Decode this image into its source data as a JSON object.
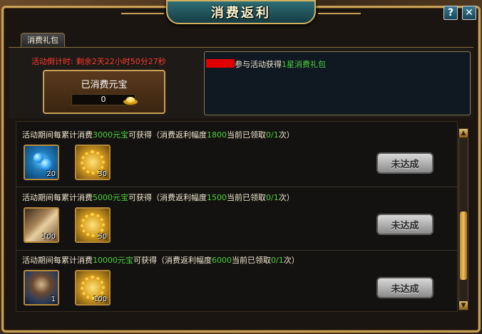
{
  "window": {
    "title": "消费返利",
    "help_label": "?",
    "close_label": "✕"
  },
  "tabs": [
    {
      "label": "消费礼包"
    }
  ],
  "countdown": {
    "label": "活动倒计时:",
    "value": "剩余2天22小时50分27秒"
  },
  "spent": {
    "title": "已消费元宝",
    "value": "0",
    "icon": "gold-ingot-icon"
  },
  "info": {
    "text_prefix": "参与活动获得",
    "text_highlight": "1星消费礼包"
  },
  "tiers": [
    {
      "prefix": "活动期间每累计消费",
      "amount": "3000元宝",
      "mid": "可获得（消费返利幅度",
      "rate": "1800",
      "suffix": "当前已领取",
      "claimed": "0/1",
      "end": "次）",
      "rewards": [
        {
          "icon": "blue-pearl-icon",
          "count": "20"
        },
        {
          "icon": "gold-coins-icon",
          "count": "30"
        }
      ],
      "button": "未达成"
    },
    {
      "prefix": "活动期间每累计消费",
      "amount": "5000元宝",
      "mid": "可获得（消费返利幅度",
      "rate": "1500",
      "suffix": "当前已领取",
      "claimed": "0/1",
      "end": "次）",
      "rewards": [
        {
          "icon": "scroll-icon",
          "count": "100"
        },
        {
          "icon": "gold-coins-icon",
          "count": "50"
        }
      ],
      "button": "未达成"
    },
    {
      "prefix": "活动期间每累计消费",
      "amount": "10000元宝",
      "mid": "可获得（消费返利幅度",
      "rate": "6000",
      "suffix": "当前已领取",
      "claimed": "0/1",
      "end": "次）",
      "rewards": [
        {
          "icon": "general-portrait-icon",
          "count": "1"
        },
        {
          "icon": "gold-coins-icon",
          "count": "100"
        }
      ],
      "button": "未达成"
    }
  ],
  "scrollbar": {
    "up_label": "▲",
    "down_label": "▼"
  }
}
